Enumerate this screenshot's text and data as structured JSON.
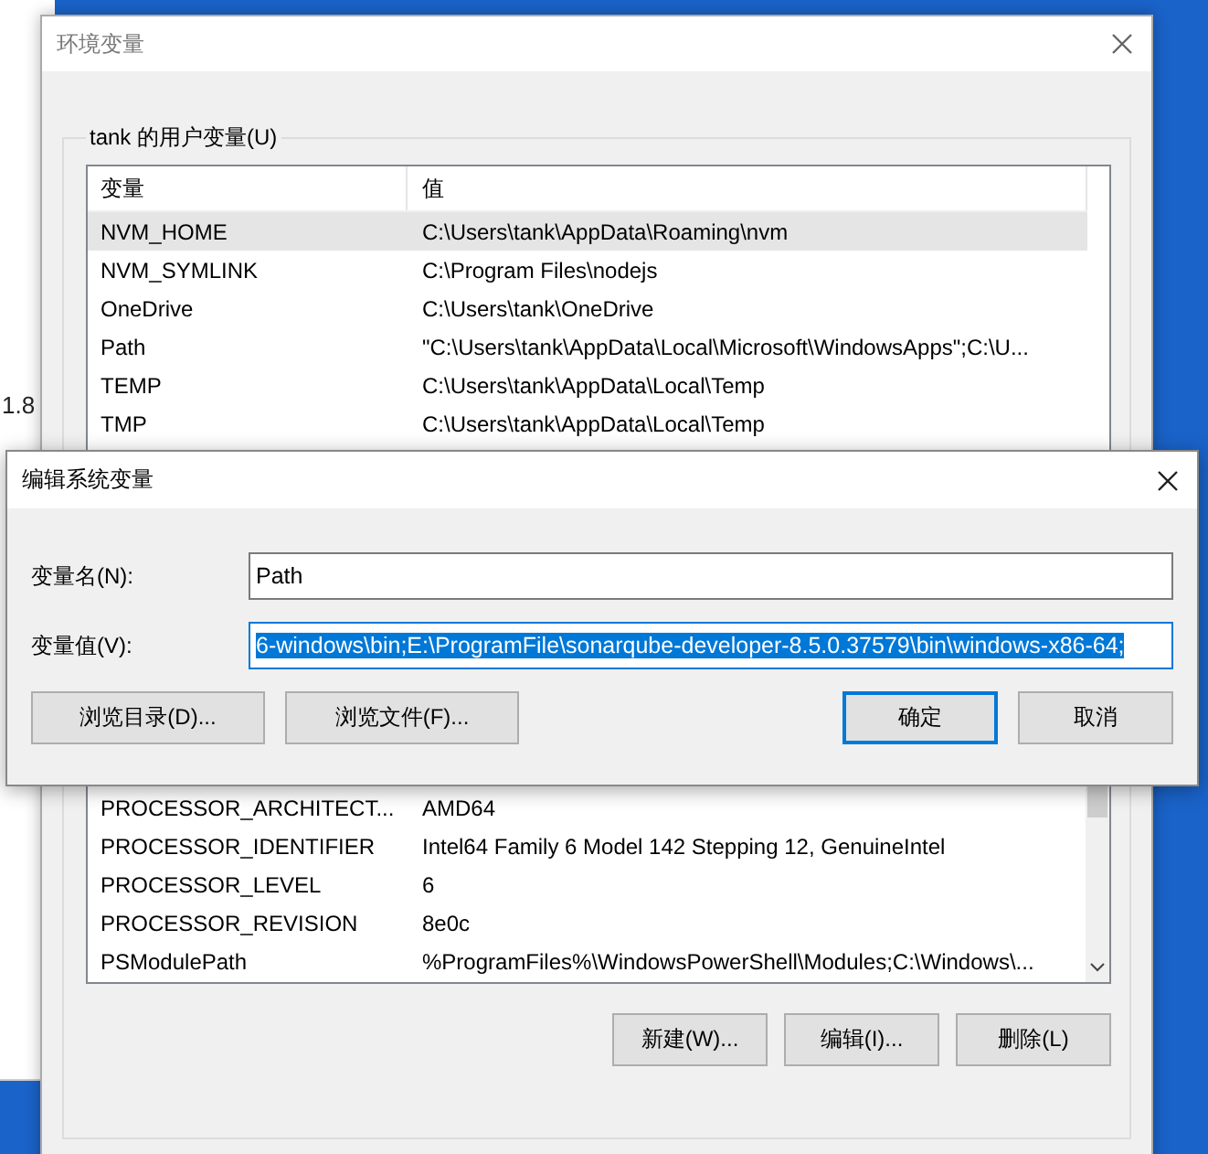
{
  "background_window": {
    "fragment": "1.8"
  },
  "env_window": {
    "title": "环境变量"
  },
  "user_variables": {
    "label": "tank 的用户变量(U)",
    "columns": [
      "变量",
      "值"
    ],
    "rows": [
      {
        "name": "NVM_HOME",
        "value": "C:\\Users\\tank\\AppData\\Roaming\\nvm",
        "selected": true
      },
      {
        "name": "NVM_SYMLINK",
        "value": "C:\\Program Files\\nodejs",
        "selected": false
      },
      {
        "name": "OneDrive",
        "value": "C:\\Users\\tank\\OneDrive",
        "selected": false
      },
      {
        "name": "Path",
        "value": "\"C:\\Users\\tank\\AppData\\Local\\Microsoft\\WindowsApps\";C:\\U...",
        "selected": false
      },
      {
        "name": "TEMP",
        "value": "C:\\Users\\tank\\AppData\\Local\\Temp",
        "selected": false
      },
      {
        "name": "TMP",
        "value": "C:\\Users\\tank\\AppData\\Local\\Temp",
        "selected": false
      }
    ]
  },
  "system_variables": {
    "rows": [
      {
        "name": "PROCESSOR_ARCHITECT...",
        "value": "AMD64",
        "selected": false
      },
      {
        "name": "PROCESSOR_IDENTIFIER",
        "value": "Intel64 Family 6 Model 142 Stepping 12, GenuineIntel",
        "selected": false
      },
      {
        "name": "PROCESSOR_LEVEL",
        "value": "6",
        "selected": false
      },
      {
        "name": "PROCESSOR_REVISION",
        "value": "8e0c",
        "selected": false
      },
      {
        "name": "PSModulePath",
        "value": "%ProgramFiles%\\WindowsPowerShell\\Modules;C:\\Windows\\...",
        "selected": false
      }
    ],
    "buttons": [
      "新建(W)...",
      "编辑(I)...",
      "删除(L)"
    ]
  },
  "edit_dialog": {
    "title": "编辑系统变量",
    "name_label": "变量名(N):",
    "name_value": "Path",
    "value_label": "变量值(V):",
    "value_value": "6-windows\\bin;E:\\ProgramFile\\sonarqube-developer-8.5.0.37579\\bin\\windows-x86-64;",
    "value_selected": true,
    "left_buttons": [
      "浏览目录(D)...",
      "浏览文件(F)..."
    ],
    "buttons": [
      {
        "label": "确定",
        "default": true
      },
      {
        "label": "取消",
        "default": false
      }
    ]
  }
}
